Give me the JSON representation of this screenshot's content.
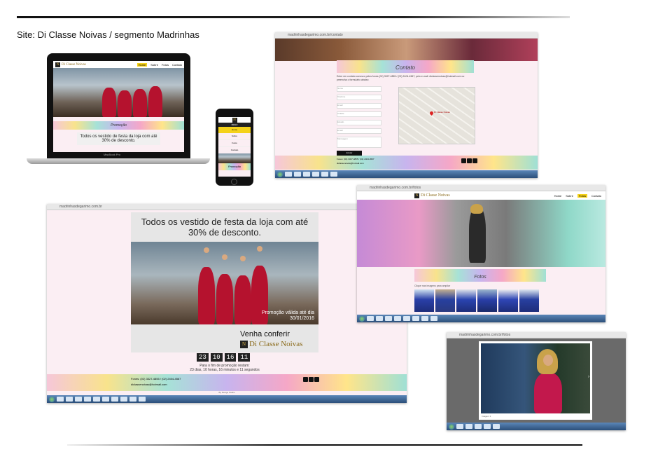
{
  "site_title": "Site: Di Classe Noivas / segmento Madrinhas",
  "laptop": {
    "nav": [
      "Home",
      "Sobre",
      "Fotos",
      "Contato"
    ],
    "section_title": "Promoção",
    "promo_text": "Todos os vestido de festa da loja com até 30% de desconto.",
    "brand_label": "MacBook Pro"
  },
  "phone": {
    "menu_label": "MENU",
    "menu_items": [
      "Home",
      "Sobre",
      "Fotos",
      "Contato"
    ],
    "section_title": "Promoção"
  },
  "contact": {
    "url": "madrinhasdegarimo.com.br/contato",
    "title": "Contato",
    "intro": "Entre em contato conosco pelos fones (02) 3327-4855 / (02) 2404-4567, pelo e-mail: diclassenoivas@hotmail.com ou preencha o formulário abaixo:",
    "fields": [
      "Nome",
      "Telefone",
      "Email",
      "Cidade",
      "Estado",
      "Email",
      "Mensagem"
    ],
    "submit": "Enviar",
    "footer_phone": "Fones: (02) 3327-4855 / (02) 2404-4567",
    "footer_email": "diclassenoivas@hotmail.com",
    "map_pin": "Di Classe Noivas"
  },
  "promo": {
    "url": "madrinhasdegarimo.com.br",
    "headline": "Todos os vestido de festa da loja com até 30% de desconto.",
    "validity": "Promoção válida até dia 30/01/2016",
    "cta": "Venha conferir",
    "brand": "Di Classe Noivas",
    "brand_mark": "N",
    "countdown": [
      "23",
      "10",
      "16",
      "11"
    ],
    "remaining_label": "Para o fim de promoção restam:",
    "remaining_text": "23 dias, 10 horas, 16 minutos e 11 segundos",
    "footer_phone": "Fones: (02) 3327-4855 / (02) 2404-4567",
    "footer_email": "diclassenoivas@hotmail.com",
    "credits": "By Design Studio"
  },
  "fotos": {
    "url": "madrinhasdegarimo.com.br/fotos",
    "nav": [
      "Home",
      "Sobre",
      "Fotos",
      "Contato"
    ],
    "active_nav": "Fotos",
    "brand": "Di Classe Noivas",
    "title": "Fotos",
    "hint": "Clique nas imagens para ampliar"
  },
  "lightbox": {
    "url": "madrinhasdegarimo.com.br/fotos",
    "caption": "Imagem 1"
  }
}
